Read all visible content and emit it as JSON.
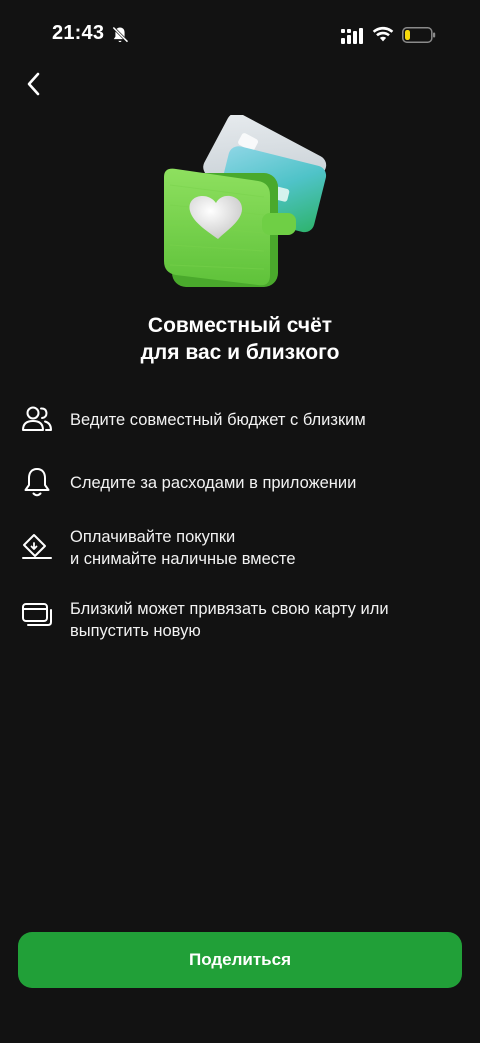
{
  "status_bar": {
    "time": "21:43",
    "icons": [
      "bell-off-icon",
      "signal-icon",
      "wifi-icon",
      "battery-icon"
    ],
    "battery_level": 0.2,
    "battery_color": "#f5d90a"
  },
  "header": {
    "back_icon": "chevron-left-icon"
  },
  "hero": {
    "image": "wallet-with-cards-illustration",
    "wallet_color": "#7ed957",
    "heart_color": "#ececec"
  },
  "title": {
    "line1": "Совместный счёт",
    "line2": "для вас и близкого"
  },
  "features": [
    {
      "icon": "people-icon",
      "lines": [
        "Ведите совместный бюджет с близким"
      ]
    },
    {
      "icon": "bell-icon",
      "lines": [
        "Следите за расходами в приложении"
      ]
    },
    {
      "icon": "cash-payment-icon",
      "lines": [
        "Оплачивайте покупки",
        "и снимайте наличные вместе"
      ]
    },
    {
      "icon": "cards-icon",
      "lines": [
        "Близкий может привязать свою карту или",
        "выпустить новую"
      ]
    }
  ],
  "share_button": {
    "label": "Поделиться",
    "color": "#21a038"
  }
}
